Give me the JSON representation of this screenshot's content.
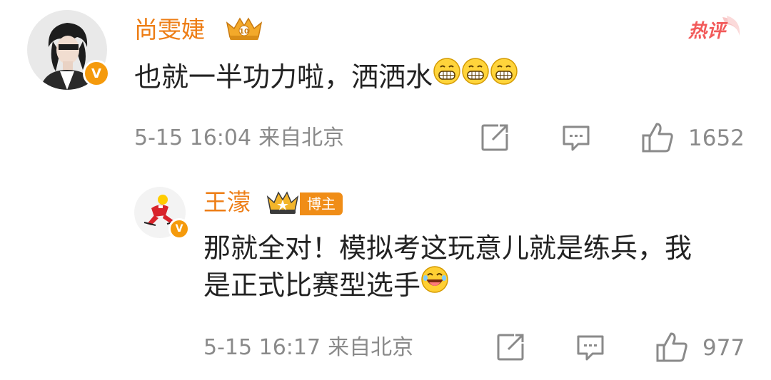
{
  "comment": {
    "username": "尚雯婕",
    "hot_label": "热评",
    "text": "也就一半功力啦，洒洒水",
    "emoji_count": 3,
    "emoji_name": "grin-emoji",
    "time": "5-15 16:04",
    "location": "来自北京",
    "likes": "1652"
  },
  "reply": {
    "username": "王濛",
    "badge": "博主",
    "text": "那就全对！模拟考这玩意儿就是练兵，我是正式比赛型选手",
    "emoji_name": "laugh-emoji",
    "time": "5-15 16:17",
    "location": "来自北京",
    "likes": "977"
  },
  "colors": {
    "username": "#ed7d15",
    "verified_badge": "#f59a0c",
    "meta_text": "#8a8a8a",
    "hot": "#f25a5a",
    "blogger_badge": "#f08d17"
  },
  "icons": {
    "verified": "V",
    "share": "share-icon",
    "comment": "comment-icon",
    "like": "thumbs-up-icon"
  }
}
